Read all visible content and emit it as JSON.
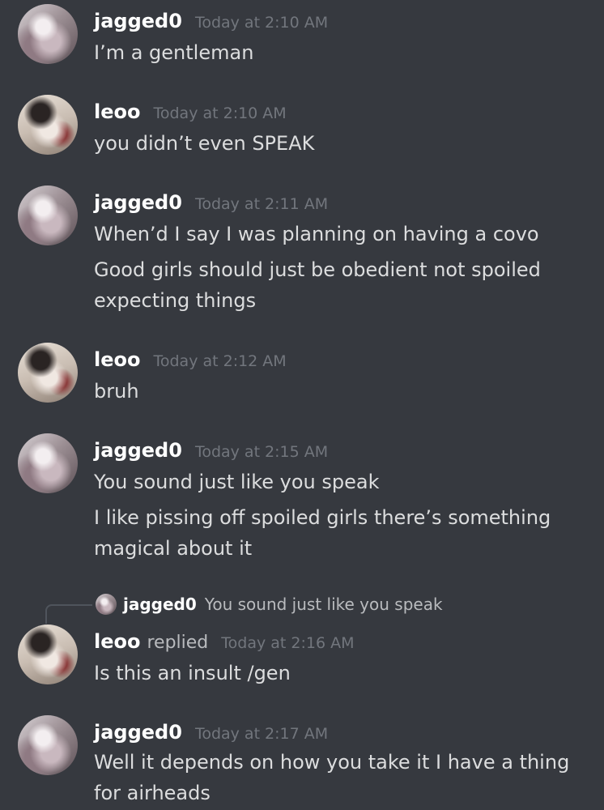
{
  "messages": [
    {
      "author": "jagged0",
      "timestamp": "Today at 2:10 AM",
      "lines": [
        "I’m a gentleman"
      ]
    },
    {
      "author": "leoo",
      "timestamp": "Today at 2:10 AM",
      "lines": [
        "you didn’t even SPEAK"
      ]
    },
    {
      "author": "jagged0",
      "timestamp": "Today at 2:11 AM",
      "lines": [
        "When’d I say I was planning on having a covo",
        "Good girls should just be obedient not spoiled",
        "expecting things"
      ]
    },
    {
      "author": "leoo",
      "timestamp": "Today at 2:12 AM",
      "lines": [
        "bruh"
      ]
    },
    {
      "author": "jagged0",
      "timestamp": "Today at 2:15 AM",
      "lines": [
        "You sound just like you speak",
        "I like pissing off spoiled girls there’s something",
        "magical about it"
      ]
    },
    {
      "author": "leoo",
      "replied_label": "replied",
      "timestamp": "Today at 2:16 AM",
      "reply_to": {
        "author": "jagged0",
        "text": "You sound just like you speak"
      },
      "lines": [
        "Is this an insult /gen"
      ]
    },
    {
      "author": "jagged0",
      "timestamp": "Today at 2:17 AM",
      "lines": [
        "Well it depends on how you take it I have a thing",
        "for airheads"
      ]
    }
  ],
  "colors": {
    "background": "#36393f",
    "username": "#ffffff",
    "message_text": "#dcddde",
    "timestamp": "#72767d"
  },
  "icons": {
    "avatar_jagged0": "user-avatar",
    "avatar_leoo": "user-avatar"
  }
}
